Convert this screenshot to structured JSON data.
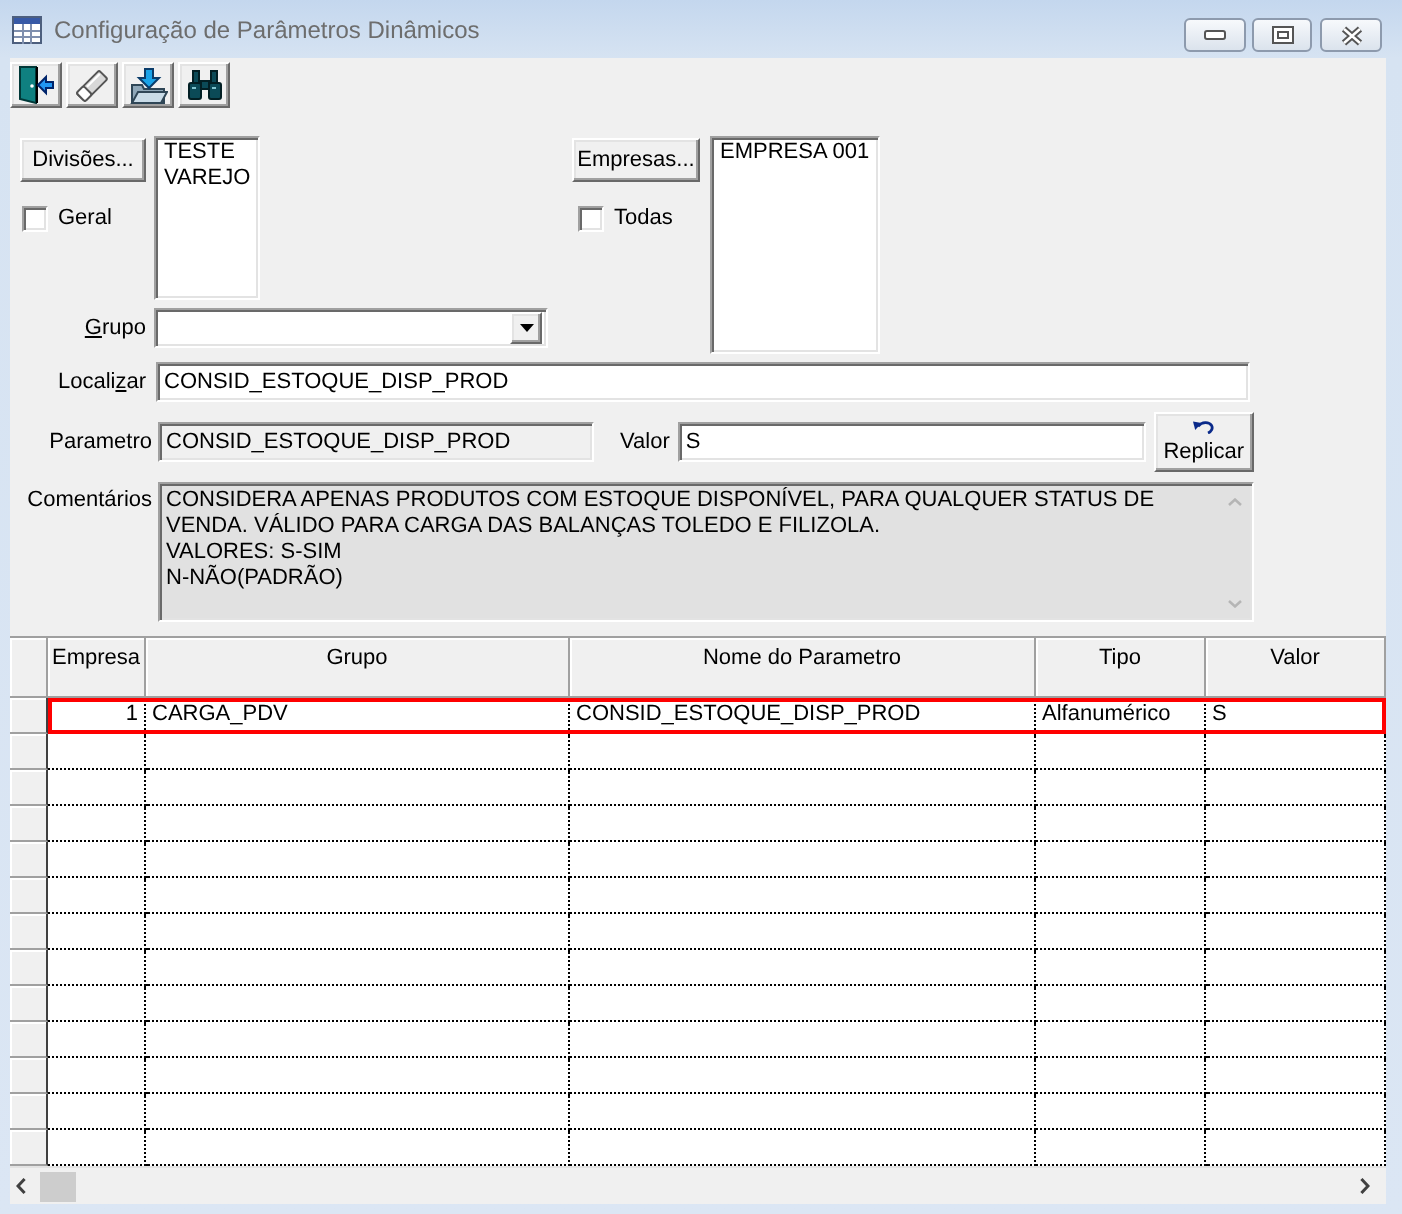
{
  "window": {
    "title": "Configuração de Parâmetros Dinâmicos"
  },
  "divisions": {
    "button": "Divisões...",
    "items": [
      {
        "text": "TESTE",
        "selected": false
      },
      {
        "text": "VAREJO",
        "selected": false
      }
    ],
    "all_checkbox": {
      "label": "Geral",
      "checked": false
    }
  },
  "companies": {
    "button": "Empresas...",
    "items": [
      {
        "text": "EMPRESA 001",
        "selected": false
      }
    ],
    "all_checkbox": {
      "label": "Todas",
      "checked": false
    }
  },
  "group": {
    "label": {
      "key": "G",
      "post": "rupo"
    }
  },
  "search": {
    "label": {
      "pre": "Locali",
      "key": "z",
      "post": "ar"
    },
    "value": "CONSID_ESTOQUE_DISP_PROD"
  },
  "parameter": {
    "label": "Parametro",
    "value": "CONSID_ESTOQUE_DISP_PROD",
    "read_only": true
  },
  "value": {
    "label": "Valor",
    "value": "S"
  },
  "replicate_button": "Replicar",
  "comments": {
    "label": "Comentários",
    "value": "CONSIDERA APENAS PRODUTOS COM ESTOQUE DISPONÍVEL, PARA QUALQUER STATUS DE\nVENDA. VÁLIDO PARA CARGA DAS BALANÇAS TOLEDO E FILIZOLA.\nVALORES: S-SIM\nN-NÃO(PADRÃO)",
    "read_only": true
  },
  "table": {
    "columns": [
      "Empresa",
      "Grupo",
      "Nome do Parametro",
      "Tipo",
      "Valor"
    ],
    "rows": [
      {
        "cells": [
          "1",
          "CARGA_PDV",
          "CONSID_ESTOQUE_DISP_PROD",
          "Alfanumérico",
          "S"
        ],
        "selected": true
      }
    ]
  }
}
